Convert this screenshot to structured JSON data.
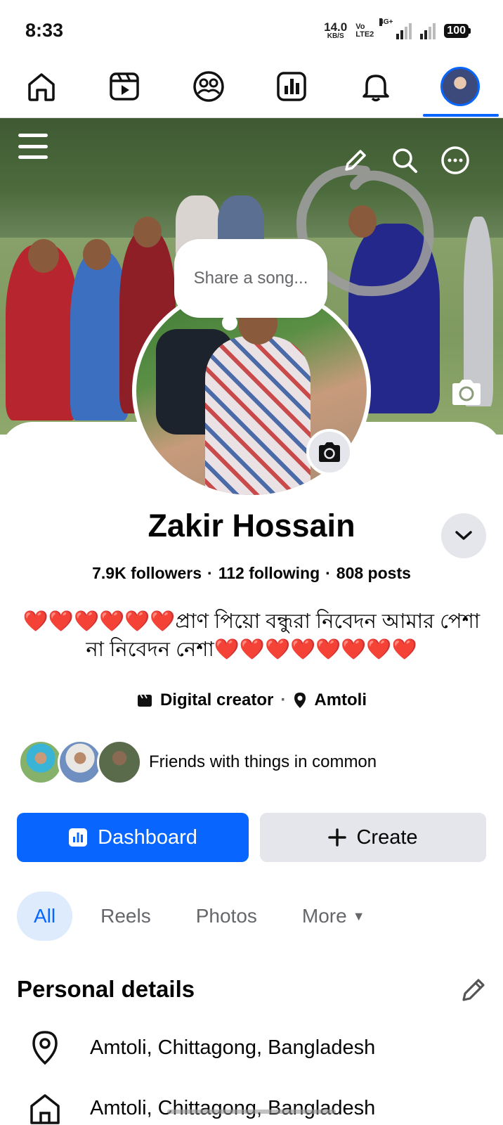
{
  "status_bar": {
    "time": "8:33",
    "speed_value": "14.0",
    "speed_unit": "KB/S",
    "volte_top": "Vo",
    "volte_bottom": "LTE2",
    "network": "4G+",
    "battery": "100"
  },
  "nav": {
    "items": [
      "home",
      "video",
      "friends",
      "dashboard",
      "notifications",
      "profile"
    ],
    "active": "profile"
  },
  "cover": {
    "song_prompt": "Share a song..."
  },
  "profile": {
    "name": "Zakir Hossain",
    "followers": "7.9K followers",
    "following": "112 following",
    "posts": "808 posts",
    "bio_line1": "❤️❤️❤️❤️❤️❤️প্রাণ পিয়ো বন্ধুরা নিবেদন আমার পেশা",
    "bio_line2": "না নিবেদন নেশা❤️❤️❤️❤️❤️❤️❤️❤️",
    "category": "Digital creator",
    "location": "Amtoli",
    "friends_text": "Friends with things in common"
  },
  "actions": {
    "dashboard_label": "Dashboard",
    "create_label": "Create"
  },
  "tabs": {
    "all": "All",
    "reels": "Reels",
    "photos": "Photos",
    "more": "More"
  },
  "personal_details": {
    "title": "Personal details",
    "current_city": "Amtoli, Chittagong, Bangladesh",
    "hometown": "Amtoli, Chittagong, Bangladesh"
  },
  "colors": {
    "accent": "#0866ff",
    "secondary_button": "#e4e6eb",
    "active_tab_bg": "#ddebfd"
  }
}
